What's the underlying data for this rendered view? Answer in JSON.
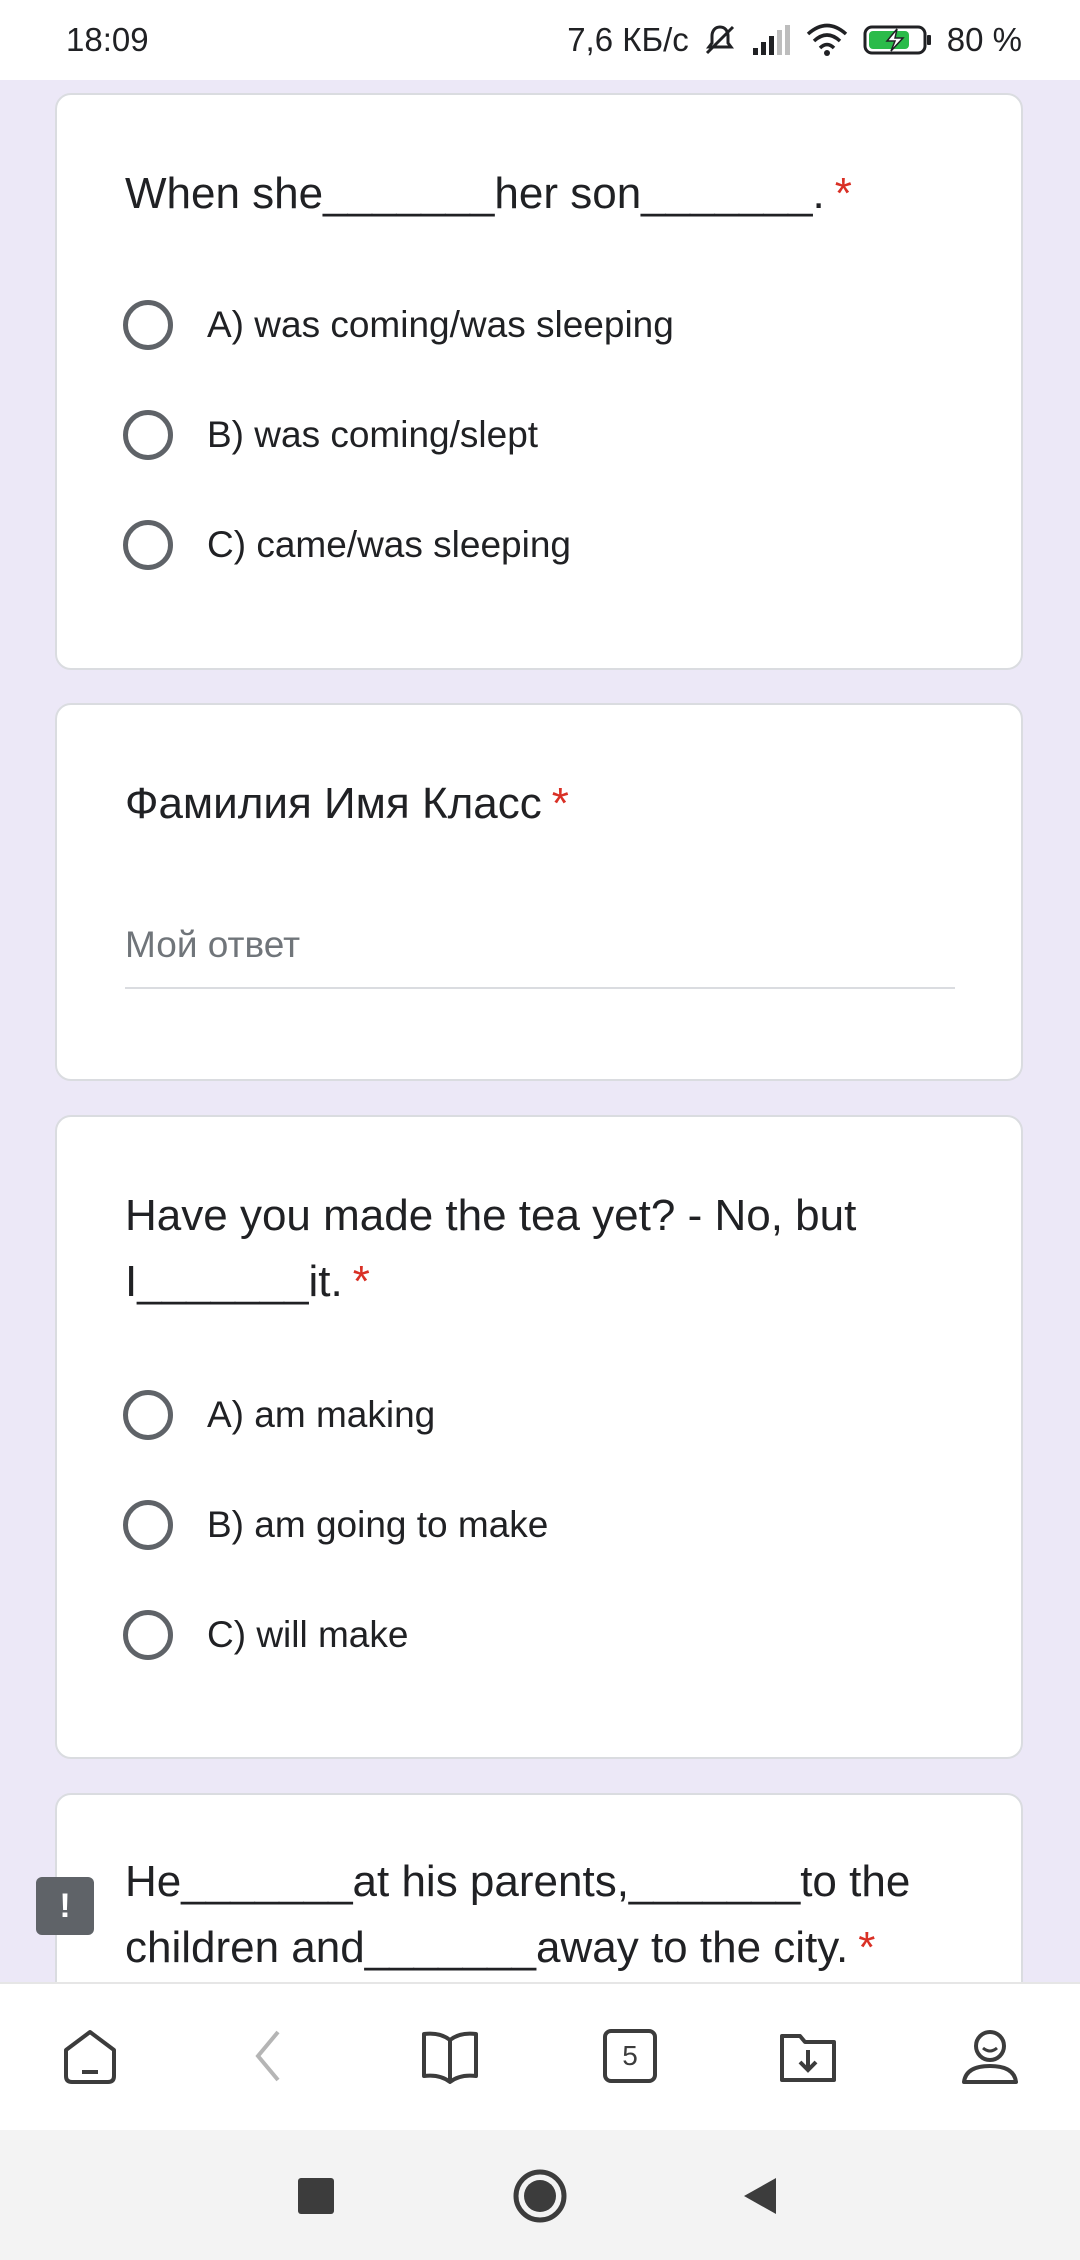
{
  "status_bar": {
    "time": "18:09",
    "net_speed": "7,6 КБ/с",
    "battery": "80 %",
    "icons": [
      "bell-muted-icon",
      "signal-icon",
      "wifi-icon",
      "battery-charging-icon"
    ]
  },
  "questions": [
    {
      "title": "When she_______her son_______.",
      "required": "*",
      "options": [
        "A) was coming/was sleeping",
        "B) was coming/slept",
        "C) came/was sleeping"
      ]
    },
    {
      "title": "Фамилия Имя Класс",
      "required": "*",
      "placeholder": "Мой ответ"
    },
    {
      "title_line1": "Have you made the tea yet? - No, but",
      "title_line2": "I_______it.",
      "required": "*",
      "options": [
        "A) am making",
        "B) am going to make",
        "C) will make"
      ]
    },
    {
      "title_line1": "He_______at his parents,_______to the",
      "title_line2": "children and_______away to the city.",
      "required": "*"
    }
  ],
  "feedback": {
    "icon": "report-feedback-icon",
    "glyph": "!"
  },
  "toolbar": {
    "tabs_count": "5",
    "icons": [
      "home-icon",
      "back-icon",
      "reader-icon",
      "tabs-icon",
      "downloads-icon",
      "profile-icon"
    ]
  },
  "system_nav": {
    "icons": [
      "recents-icon",
      "home-icon",
      "back-icon"
    ]
  },
  "colors": {
    "background": "#ece8f7",
    "required": "#d93025",
    "radio": "#5f6368"
  }
}
